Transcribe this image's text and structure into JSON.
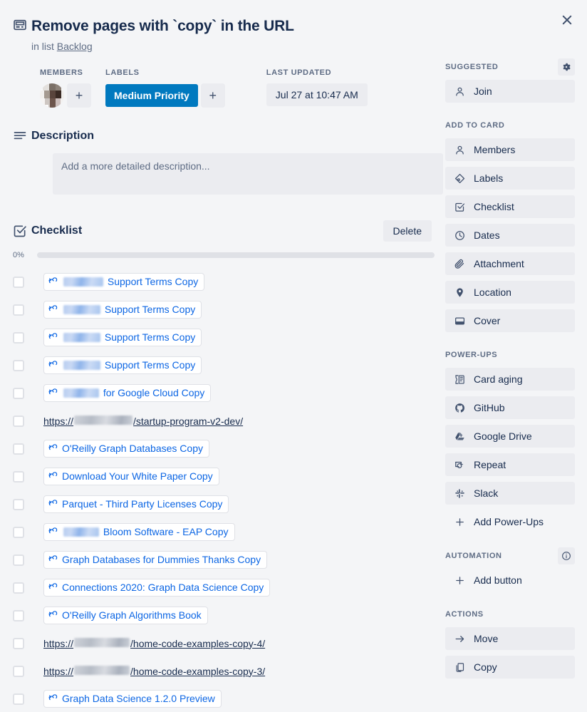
{
  "close_label": "×",
  "header": {
    "icon": "card-icon",
    "title": "Remove pages with `copy` in the URL",
    "in_list_prefix": "in list",
    "list_name": "Backlog"
  },
  "meta": {
    "members_label": "MEMBERS",
    "labels_label": "LABELS",
    "updated_label": "LAST UPDATED",
    "add_member_glyph": "+",
    "add_label_glyph": "+",
    "label_chip": "Medium Priority",
    "label_chip_color": "#0079bf",
    "updated_value": "Jul 27 at 10:47 AM"
  },
  "description": {
    "title": "Description",
    "placeholder": "Add a more detailed description..."
  },
  "checklist": {
    "title": "Checklist",
    "delete_label": "Delete",
    "progress_pct_label": "0%",
    "progress_value": 0,
    "items": [
      {
        "type": "pill",
        "redacted_before": 56,
        "text_after": "Support Terms  Copy"
      },
      {
        "type": "pill",
        "redacted_before": 52,
        "text_after": "Support Terms  Copy"
      },
      {
        "type": "pill",
        "redacted_before": 52,
        "text_after": "Support Terms  Copy"
      },
      {
        "type": "pill",
        "redacted_before": 52,
        "text_after": "Support Terms  Copy"
      },
      {
        "type": "pill",
        "redacted_before": 50,
        "text_after": "for Google Cloud Copy"
      },
      {
        "type": "url",
        "prefix": "https://",
        "redacted_mid": 82,
        "suffix": "/startup-program-v2-dev/"
      },
      {
        "type": "pill",
        "redacted_before": 0,
        "text_after": "O'Reilly Graph Databases  Copy"
      },
      {
        "type": "pill",
        "redacted_before": 0,
        "text_after": "Download Your White Paper  Copy"
      },
      {
        "type": "pill",
        "redacted_before": 0,
        "text_after": "Parquet - Third Party Licenses  Copy"
      },
      {
        "type": "pill",
        "redacted_before": 50,
        "text_after": "Bloom Software - EAP  Copy"
      },
      {
        "type": "pill",
        "redacted_before": 0,
        "text_after": "Graph Databases for Dummies Thanks Copy"
      },
      {
        "type": "pill",
        "redacted_before": 0,
        "text_after": "Connections 2020: Graph Data Science Copy"
      },
      {
        "type": "pill",
        "redacted_before": 0,
        "text_after": "O'Reilly Graph Algorithms Book"
      },
      {
        "type": "url",
        "prefix": "https://",
        "redacted_mid": 78,
        "suffix": "/home-code-examples-copy-4/"
      },
      {
        "type": "url",
        "prefix": "https://",
        "redacted_mid": 78,
        "suffix": "/home-code-examples-copy-3/"
      },
      {
        "type": "pill",
        "redacted_before": 0,
        "text_after": "Graph Data Science 1.2.0 Preview"
      }
    ]
  },
  "sidebar": {
    "groups": [
      {
        "heading": "SUGGESTED",
        "heading_action": "gear-icon",
        "items": [
          {
            "label": "Join",
            "icon": "person-icon"
          }
        ]
      },
      {
        "heading": "ADD TO CARD",
        "items": [
          {
            "label": "Members",
            "icon": "person-icon"
          },
          {
            "label": "Labels",
            "icon": "label-icon"
          },
          {
            "label": "Checklist",
            "icon": "checklist-icon"
          },
          {
            "label": "Dates",
            "icon": "clock-icon"
          },
          {
            "label": "Attachment",
            "icon": "paperclip-icon"
          },
          {
            "label": "Location",
            "icon": "location-pin-icon"
          },
          {
            "label": "Cover",
            "icon": "cover-icon"
          }
        ]
      },
      {
        "heading": "POWER-UPS",
        "items": [
          {
            "label": "Card aging",
            "icon": "card-aging-icon"
          },
          {
            "label": "GitHub",
            "icon": "github-icon"
          },
          {
            "label": "Google Drive",
            "icon": "google-drive-icon"
          },
          {
            "label": "Repeat",
            "icon": "repeat-icon"
          },
          {
            "label": "Slack",
            "icon": "slack-icon"
          },
          {
            "label": "Add Power-Ups",
            "icon": "plus-icon",
            "plain": true
          }
        ]
      },
      {
        "heading": "AUTOMATION",
        "heading_action": "info-icon",
        "items": [
          {
            "label": "Add button",
            "icon": "plus-icon",
            "plain": true
          }
        ]
      },
      {
        "heading": "ACTIONS",
        "items": [
          {
            "label": "Move",
            "icon": "arrow-right-icon"
          },
          {
            "label": "Copy",
            "icon": "copy-icon"
          }
        ]
      }
    ]
  }
}
